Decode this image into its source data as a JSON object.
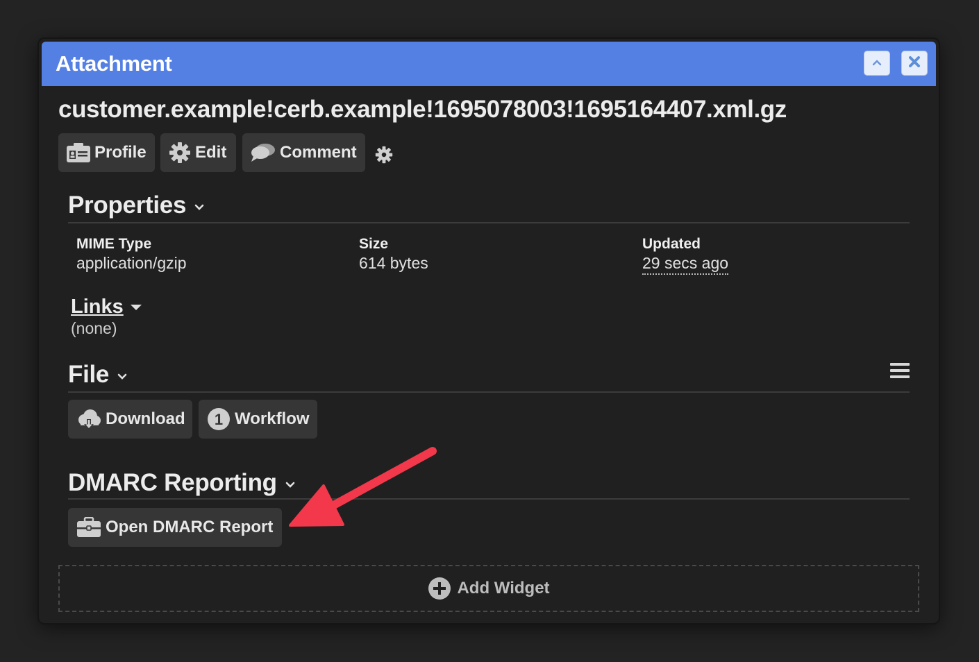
{
  "dialog": {
    "title": "Attachment",
    "collapse_icon": "chevron-up-icon",
    "close_icon": "close-icon"
  },
  "record": {
    "name": "customer.example!cerb.example!1695078003!1695164407.xml.gz"
  },
  "toolbar": {
    "profile_label": "Profile",
    "edit_label": "Edit",
    "comment_label": "Comment",
    "settings_icon": "gear-icon"
  },
  "properties": {
    "heading": "Properties",
    "items": [
      {
        "label": "MIME Type",
        "value": "application/gzip"
      },
      {
        "label": "Size",
        "value": "614 bytes"
      },
      {
        "label": "Updated",
        "value": "29 secs ago"
      }
    ]
  },
  "links": {
    "heading": "Links",
    "value": "(none)"
  },
  "file": {
    "heading": "File",
    "download_label": "Download",
    "workflow_count": "1",
    "workflow_label": "Workflow"
  },
  "dmarc": {
    "heading": "DMARC Reporting",
    "open_label": "Open DMARC Report"
  },
  "add_widget": {
    "label": "Add Widget"
  },
  "colors": {
    "titlebar": "#5480e4",
    "background": "#202020",
    "button": "#363636",
    "annotation_arrow": "#f2384a"
  }
}
